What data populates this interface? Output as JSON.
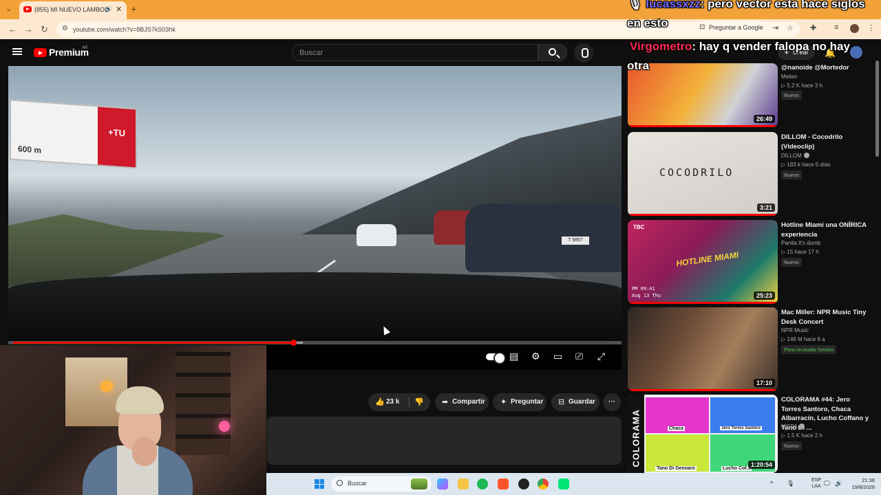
{
  "browser": {
    "tab_title": "(855) MI NUEVO LAMBORG",
    "url": "youtube.com/watch?v=8BJS7kS03hk",
    "google_pill": "Preguntar a Google"
  },
  "youtube": {
    "brand": "Premium",
    "country": "AR",
    "search_placeholder": "Buscar",
    "create_label": "Crear"
  },
  "video": {
    "billboard_distance": "600 m",
    "billboard_brand": "+TU",
    "plate": "T 9857",
    "progress_fraction": 0.468,
    "buffer_fraction": 0.484
  },
  "actions": {
    "likes": "23 k",
    "share": "Compartir",
    "ask": "Preguntar",
    "save": "Guardar"
  },
  "chat": [
    {
      "user": "lucassxzz",
      "message": ": pero vector esta hace siglos",
      "user_color": "#7a6cff"
    },
    {
      "message": "en esto"
    },
    {
      "user": "Virgometro",
      "message": ": hay q vender falopa no hay",
      "user_color": "#ff2a55"
    },
    {
      "message": "otra"
    }
  ],
  "sidebar": [
    {
      "title": "@nanoide @Mortedor",
      "channel": "Melian",
      "meta": "▷ 5.2 K  hace 3 h",
      "badge": "Nuevo",
      "duration": "26:49",
      "colors": [
        "#e9572d",
        "#f3b23a",
        "#5b3a8c"
      ]
    },
    {
      "title": "DILLOM - Cocodrilo (Videoclip)",
      "channel": "DILLOM",
      "meta": "▷ 183 k  hace 5 días",
      "badge": "Nuevo",
      "duration": "3:21",
      "thumb_text": "COCODRILO",
      "colors": [
        "#e3dfda",
        "#d3cec8"
      ]
    },
    {
      "title": "Hotline Miami una ONÍRICA experiencia",
      "channel": "Panita It's dumb",
      "meta": "▷ 15  hace 17 h",
      "badge": "Nuevo",
      "duration": "25:23",
      "thumb_text": "HOTLINE MIAMI",
      "thumb_tag": "TBC",
      "thumb_time": "PM 09:41",
      "thumb_date": "Aug 13 Thu",
      "colors": [
        "#c0245e",
        "#1e7a6d",
        "#f7d43a"
      ]
    },
    {
      "title": "Mac Miller: NPR Music Tiny Desk Concert",
      "channel": "NPR Music",
      "meta": "▷ 146 M  hace 8 a",
      "badge": "Para recaudar fondos",
      "duration": "17:10",
      "colors": [
        "#6b4a36",
        "#a57e5c",
        "#2e2724"
      ]
    },
    {
      "title": "COLORAMA #44: Jero Torres Santoro, Chaca Albarracín, Lucho Coffano y Tano Di ...",
      "channel": "HISPA",
      "meta": "▷ 1.5 K  hace 2 h",
      "badge": "Nuevo",
      "duration": "1:20:54",
      "thumb_text": "COLORAMA",
      "names": [
        "Chaca",
        "Jero Torres Santoro",
        "Tano Di Gennaro",
        "Lucho Cof..."
      ],
      "colors": [
        "#e535c8",
        "#3a7df0",
        "#c9e83a",
        "#40d67a"
      ]
    }
  ],
  "taskbar": {
    "search_label": "Buscar",
    "lang_top": "ESP",
    "lang_bottom": "LAA",
    "time": "21:38",
    "date": "19/8/2026"
  }
}
